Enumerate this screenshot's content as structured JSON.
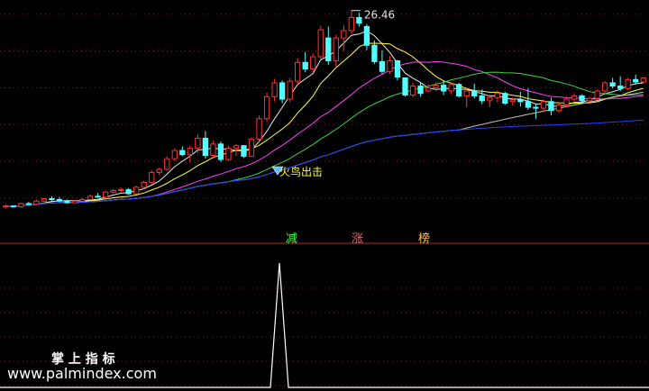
{
  "chart_data": [
    {
      "type": "candlestick",
      "title": "",
      "y_range": [
        1.8,
        27.2
      ],
      "hline_levels": [
        3.5,
        8.0,
        12.5,
        17.0,
        21.5,
        26.0
      ],
      "annotations": {
        "peak_label": "26.46",
        "signal_label": "火鸟出击"
      },
      "candles": [
        [
          2.4,
          2.7,
          2.2,
          2.5
        ],
        [
          2.5,
          2.6,
          2.3,
          2.4
        ],
        [
          2.4,
          2.9,
          2.3,
          2.8
        ],
        [
          2.8,
          3.0,
          2.6,
          2.7
        ],
        [
          2.7,
          3.3,
          2.6,
          3.1
        ],
        [
          3.1,
          3.5,
          3.0,
          3.4
        ],
        [
          3.4,
          3.7,
          3.1,
          3.3
        ],
        [
          3.3,
          3.6,
          3.0,
          3.1
        ],
        [
          3.1,
          3.3,
          2.8,
          2.9
        ],
        [
          2.9,
          3.2,
          2.8,
          3.1
        ],
        [
          3.1,
          3.5,
          2.9,
          3.3
        ],
        [
          3.3,
          3.9,
          3.2,
          3.7
        ],
        [
          3.7,
          4.1,
          3.5,
          3.6
        ],
        [
          3.6,
          4.4,
          3.5,
          4.2
        ],
        [
          4.2,
          4.6,
          4.0,
          4.4
        ],
        [
          4.4,
          4.8,
          4.2,
          4.5
        ],
        [
          4.5,
          4.7,
          3.9,
          4.0
        ],
        [
          4.0,
          5.0,
          3.9,
          4.8
        ],
        [
          4.8,
          5.6,
          4.6,
          5.4
        ],
        [
          5.4,
          6.9,
          5.2,
          6.6
        ],
        [
          6.6,
          7.2,
          6.3,
          7.0
        ],
        [
          7.0,
          8.6,
          6.8,
          8.3
        ],
        [
          8.3,
          9.6,
          8.0,
          9.3
        ],
        [
          9.3,
          9.8,
          8.6,
          8.8
        ],
        [
          8.8,
          9.9,
          7.8,
          9.6
        ],
        [
          9.6,
          11.3,
          9.0,
          10.8
        ],
        [
          10.8,
          11.7,
          8.3,
          8.7
        ],
        [
          8.7,
          10.5,
          8.3,
          10.1
        ],
        [
          10.1,
          10.4,
          7.9,
          8.2
        ],
        [
          8.2,
          9.9,
          8.0,
          9.6
        ],
        [
          9.6,
          10.1,
          8.6,
          9.9
        ],
        [
          9.9,
          9.9,
          8.4,
          8.6
        ],
        [
          8.6,
          10.9,
          8.5,
          10.7
        ],
        [
          10.7,
          13.6,
          10.4,
          13.2
        ],
        [
          13.2,
          16.4,
          12.8,
          15.9
        ],
        [
          15.9,
          18.1,
          15.3,
          17.6
        ],
        [
          17.6,
          17.9,
          15.1,
          15.6
        ],
        [
          15.6,
          18.2,
          15.2,
          17.8
        ],
        [
          17.8,
          20.6,
          17.4,
          20.1
        ],
        [
          20.1,
          21.4,
          18.9,
          19.3
        ],
        [
          19.3,
          21.2,
          18.8,
          20.8
        ],
        [
          20.8,
          24.6,
          20.4,
          24.1
        ],
        [
          23.1,
          24.5,
          19.8,
          20.3
        ],
        [
          20.3,
          23.5,
          19.6,
          23.1
        ],
        [
          23.1,
          24.7,
          21.5,
          24.0
        ],
        [
          24.0,
          26.46,
          23.6,
          25.6
        ],
        [
          25.6,
          26.2,
          24.5,
          24.9
        ],
        [
          24.5,
          24.8,
          21.6,
          22.2
        ],
        [
          22.2,
          22.8,
          19.9,
          20.2
        ],
        [
          20.2,
          21.6,
          18.7,
          19.0
        ],
        [
          19.0,
          20.9,
          18.7,
          20.3
        ],
        [
          20.3,
          20.4,
          17.9,
          18.3
        ],
        [
          18.2,
          17.5,
          15.9,
          16.1
        ],
        [
          16.1,
          17.6,
          15.8,
          17.2
        ],
        [
          17.2,
          17.6,
          15.9,
          16.3
        ],
        [
          16.6,
          17.4,
          16.4,
          17.0
        ],
        [
          17.0,
          17.7,
          16.6,
          17.3
        ],
        [
          17.3,
          17.8,
          16.1,
          16.6
        ],
        [
          16.6,
          17.7,
          16.2,
          17.4
        ],
        [
          17.4,
          17.6,
          15.8,
          16.0
        ],
        [
          16.0,
          17.0,
          14.6,
          16.6
        ],
        [
          16.6,
          17.5,
          15.7,
          16.0
        ],
        [
          16.0,
          16.8,
          15.0,
          15.4
        ],
        [
          15.4,
          16.2,
          14.6,
          15.8
        ],
        [
          15.8,
          16.7,
          15.2,
          16.3
        ],
        [
          16.3,
          16.5,
          14.9,
          15.1
        ],
        [
          15.3,
          15.8,
          14.8,
          15.5
        ],
        [
          15.5,
          16.5,
          14.7,
          15.3
        ],
        [
          15.3,
          16.9,
          14.3,
          14.6
        ],
        [
          14.6,
          15.0,
          13.2,
          14.5
        ],
        [
          14.5,
          15.4,
          14.0,
          15.3
        ],
        [
          15.3,
          15.8,
          13.6,
          14.2
        ],
        [
          14.2,
          15.2,
          13.9,
          14.9
        ],
        [
          14.9,
          15.9,
          14.6,
          15.6
        ],
        [
          15.6,
          16.3,
          15.3,
          16.0
        ],
        [
          16.0,
          16.2,
          15.2,
          15.4
        ],
        [
          15.4,
          15.9,
          15.0,
          15.7
        ],
        [
          15.7,
          16.8,
          15.5,
          16.6
        ],
        [
          16.6,
          17.8,
          16.3,
          17.6
        ],
        [
          17.6,
          18.2,
          16.9,
          17.2
        ],
        [
          17.2,
          18.4,
          16.6,
          16.9
        ],
        [
          16.9,
          18.2,
          16.7,
          18.0
        ],
        [
          18.0,
          18.6,
          17.4,
          17.7
        ],
        [
          17.7,
          18.3,
          17.5,
          18.2
        ]
      ],
      "signal_bar_index": 41,
      "colors": {
        "up": "#ff3030",
        "down": "#54ffff",
        "background": "#000000",
        "ma_white": "#e8e8e8",
        "ma_yellow": "#ffff40",
        "ma_magenta": "#ff40ff",
        "ma_green": "#40d040",
        "ma_gray": "#c0c0c0",
        "ma_blue": "#2040ff",
        "separator": "#c02020",
        "grid": "#8a1818",
        "signal_text": "#ffff40"
      }
    },
    {
      "type": "line",
      "title": "",
      "y_range": [
        0,
        1
      ],
      "series": [
        {
          "values": [
            0,
            0,
            0,
            0,
            0,
            0,
            0,
            0,
            0,
            0,
            0,
            0,
            0,
            0,
            0,
            0,
            0,
            0,
            0,
            0,
            0,
            0,
            0,
            0,
            0,
            0,
            0,
            0,
            0,
            0,
            0,
            0,
            0,
            0,
            0,
            0,
            0,
            0,
            0,
            0,
            0,
            1,
            0,
            0,
            0,
            0,
            0,
            0,
            0,
            0,
            0,
            0,
            0,
            0,
            0,
            0,
            0,
            0,
            0,
            0,
            0,
            0,
            0,
            0,
            0,
            0,
            0,
            0,
            0,
            0,
            0,
            0,
            0,
            0,
            0,
            0,
            0,
            0,
            0,
            0,
            0,
            0,
            0,
            0
          ]
        }
      ],
      "color": "#ffffff"
    }
  ],
  "indicator_labels": [
    {
      "text": "减",
      "color": "#40ff40"
    },
    {
      "text": "涨",
      "color": "#ff6060"
    },
    {
      "text": "榜",
      "color": "#ffc040"
    }
  ],
  "watermark": {
    "line1": "掌 上 指 标",
    "line2": "www.palmindex.com"
  }
}
